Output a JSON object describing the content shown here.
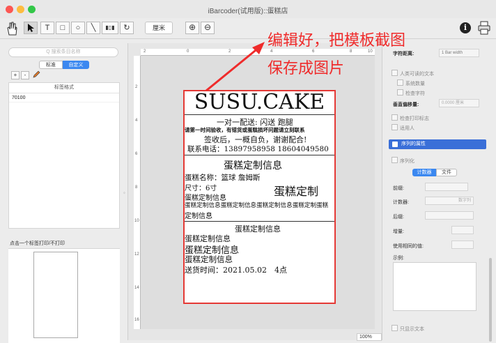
{
  "window": {
    "title": "iBarcoder(试用版)::蛋糕店"
  },
  "toolbar": {
    "text_tool": "T",
    "rect_tool": "□",
    "ellipse_tool": "○",
    "line_tool": "╲",
    "barcode_tool": "▮▯▮",
    "rotate_tool": "↻",
    "unit": "厘米",
    "zoom_in": "⊕",
    "zoom_out": "⊖",
    "info": "i"
  },
  "left_panel": {
    "search_placeholder": "Q 搜索条目名称",
    "tab_standard": "标准",
    "tab_custom": "自定义",
    "add_label": "+",
    "remove_label": "-",
    "list_header": "标签格式",
    "list_items": [
      "70100"
    ],
    "print_caption": "点击一个标签打印/不打印"
  },
  "ruler": {
    "h_ticks": [
      "2",
      "0",
      "2",
      "4",
      "6",
      "8",
      "10"
    ],
    "v_ticks": [
      "2",
      "4",
      "6",
      "8",
      "10",
      "12",
      "14",
      "16"
    ]
  },
  "label": {
    "title": "SUSU.CAKE",
    "line1": "一对一配送: 闪送 跑腿",
    "line2": "请第一时间验收，有错货或蛋糕损坏问题请立刻联系",
    "line3": "签收后，一概自负，谢谢配合!",
    "line4": "联系电话：13897958958 18604049580",
    "section_title": "蛋糕定制信息",
    "name_line": "蛋糕名称：篮球 詹姆斯",
    "size_line": "尺寸：6寸",
    "custom_big": "蛋糕定制",
    "info_a": "蛋糕定制信息",
    "info_b": "蛋糕定制信息蛋糕定制信息蛋糕定制信息蛋糕定制蛋糕",
    "info_c": "定制信息",
    "section2_title": "蛋糕定制信息",
    "info_d": "蛋糕定制信息",
    "info_e": "蛋糕定制信息",
    "info_f": "蛋糕定制信息",
    "delivery": "送货时间：2021.05.02　4点"
  },
  "status": {
    "zoom": "100%"
  },
  "right_panel": {
    "char_spacing_label": "字符距离:",
    "char_spacing_value": "1 Bar width",
    "human_readable": "人类可读的文本",
    "system_digits": "系统数量",
    "check_char": "检查字符",
    "vertical_offset_label": "垂直偏移量:",
    "vertical_offset_value": "0.0000 厘米",
    "check_print": "检查打印标志",
    "quiet_zone": "适用人",
    "serialize_section": "序列的属性",
    "serialize": "序列化",
    "tab_counter": "计数器",
    "tab_file": "文件",
    "prefix_label": "前缀:",
    "counter_label": "计数器:",
    "counter_value": "数字列",
    "suffix_label": "后缀:",
    "increment_label": "增量:",
    "repeat_label": "使用相同的值:",
    "example_label": "示例:",
    "show_text": "只显示文本"
  },
  "annotation": {
    "line1": "编辑好，把模板截图",
    "line2": "保存成图片"
  },
  "colors": {
    "annotation_red": "#ef2b2b",
    "selection_blue": "#3b88f0",
    "label_border": "#e53935"
  }
}
